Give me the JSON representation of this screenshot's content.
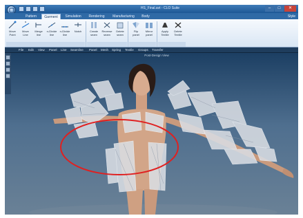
{
  "window": {
    "title": "HS_Final.avt - CLO Suite",
    "controls": {
      "minimize": "–",
      "maximize": "□",
      "close": "✕"
    }
  },
  "ribbon": {
    "style_label": "Style",
    "tabs": [
      {
        "label": "Pattern",
        "active": false
      },
      {
        "label": "Garment",
        "active": true
      },
      {
        "label": "Simulation",
        "active": false
      },
      {
        "label": "Rendering",
        "active": false
      },
      {
        "label": "Manufacturing",
        "active": false
      },
      {
        "label": "Body",
        "active": false
      }
    ],
    "buttons": [
      {
        "label": "Move\nPoint",
        "icon": "move-point-icon"
      },
      {
        "label": "Move\nLine",
        "icon": "move-line-icon"
      },
      {
        "label": "Merge\nline",
        "icon": "merge-line-icon"
      },
      {
        "label": "n-Divide\nline",
        "icon": "n-divide-line-icon"
      },
      {
        "label": "n-Divide\nline",
        "icon": "n-divide-line-2-icon"
      },
      {
        "label": "Notch",
        "icon": "notch-icon"
      },
      {
        "label": "Create\nseam",
        "icon": "create-seam-icon"
      },
      {
        "label": "Reverse\nseam",
        "icon": "reverse-seam-icon"
      },
      {
        "label": "Delete\nseam",
        "icon": "delete-seam-icon"
      },
      {
        "label": "Flip\npanel",
        "icon": "flip-panel-icon"
      },
      {
        "label": "Mirror\npanel",
        "icon": "mirror-panel-icon"
      },
      {
        "label": "Apply\nTextile",
        "icon": "apply-textile-icon"
      },
      {
        "label": "Delete\nTextile",
        "icon": "delete-textile-icon"
      }
    ]
  },
  "menubar": {
    "items": [
      "File",
      "Edit",
      "View",
      "Panel",
      "Line",
      "Seamline",
      "Panel",
      "Mesh",
      "Spring",
      "Textile",
      "Groups",
      "Transfer"
    ]
  },
  "viewport": {
    "title": "Post-Design View"
  },
  "colors": {
    "annotation": "#e02020",
    "titlebar": "#2a64a3",
    "ribbon_bg": "#e8f0f9",
    "viewport_bg": "#3f5f80",
    "skin": "#d2a588"
  }
}
